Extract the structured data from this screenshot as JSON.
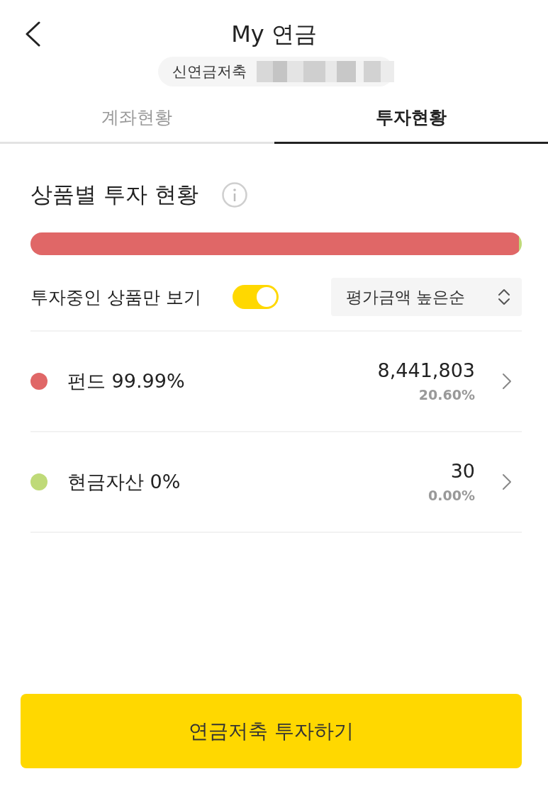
{
  "header": {
    "title": "My 연금",
    "account": {
      "label": "신연금저축"
    }
  },
  "tabs": [
    {
      "label": "계좌현황",
      "selected": false
    },
    {
      "label": "투자현황",
      "selected": true
    }
  ],
  "section": {
    "title": "상품별 투자 현황"
  },
  "filter": {
    "label": "투자중인 상품만 보기",
    "on": true
  },
  "sort": {
    "label": "평가금액 높은순"
  },
  "holdings": [
    {
      "name": "펀드 99.99%",
      "amount": "8,441,803",
      "return": "20.60%",
      "color": "#e06767",
      "level": 0.994
    },
    {
      "name": "현금자산 0%",
      "amount": "30",
      "return": "0.00%",
      "color": "#bfda78",
      "level": 0.006
    }
  ],
  "button": {
    "label": "연금저축 투자하기"
  }
}
